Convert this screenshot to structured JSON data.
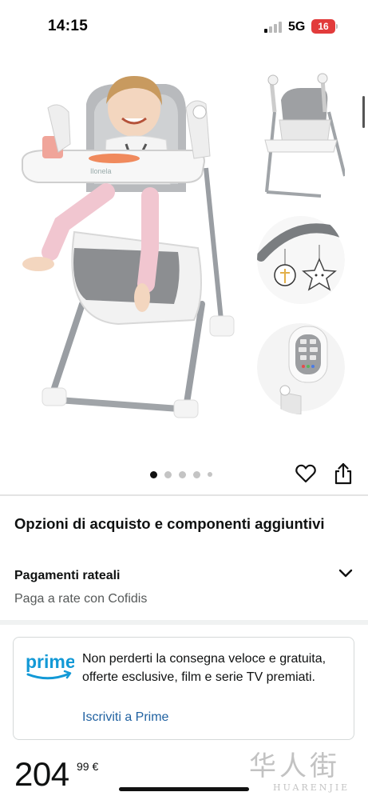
{
  "status_bar": {
    "time": "14:15",
    "network": "5G",
    "battery": "16"
  },
  "gallery": {
    "image_count": 5,
    "active_index": 0,
    "main_image_label": "Ilonela",
    "icons": {
      "favorite": "heart-icon",
      "share": "share-icon"
    }
  },
  "purchase_options": {
    "title": "Opzioni di acquisto e componenti aggiuntivi",
    "installments": {
      "title": "Pagamenti rateali",
      "subtitle": "Paga a rate con Cofidis",
      "icon": "chevron-down-icon"
    }
  },
  "prime": {
    "logo_text": "prime",
    "message": "Non perderti la consegna veloce e gratuita, offerte esclusive, film e serie TV premiati.",
    "link": "Iscriviti a Prime",
    "colors": {
      "brand": "#1399d6",
      "link": "#2162a1"
    }
  },
  "price": {
    "whole": "204",
    "fraction": "99 €"
  },
  "watermark": {
    "chinese": "华人街",
    "latin": "HUARENJIE"
  }
}
